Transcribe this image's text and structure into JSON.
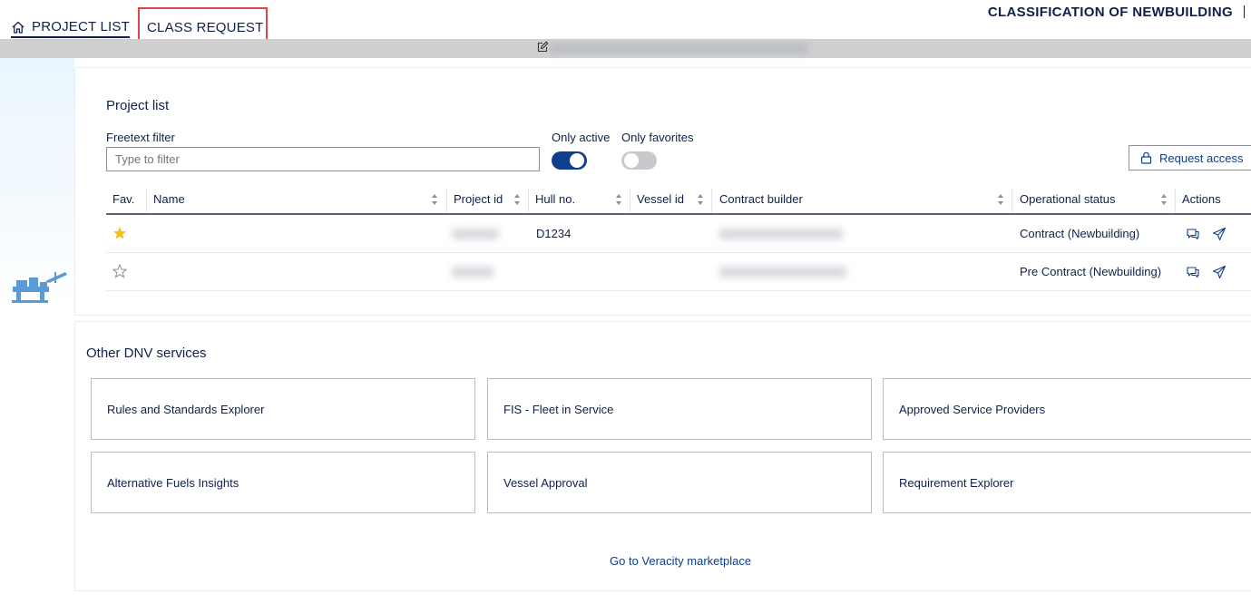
{
  "nav": {
    "project_list_label": "PROJECT LIST",
    "class_request_label": "CLASS REQUEST",
    "app_title": "CLASSIFICATION OF NEWBUILDING"
  },
  "project_list": {
    "title": "Project list",
    "freetext_label": "Freetext filter",
    "filter_placeholder": "Type to filter",
    "filter_value": "",
    "only_active_label": "Only active",
    "only_active_on": true,
    "only_favorites_label": "Only favorites",
    "only_favorites_on": false,
    "request_access_label": "Request access",
    "columns": [
      "Fav.",
      "Name",
      "Project id",
      "Hull no.",
      "Vessel id",
      "Contract builder",
      "Operational status",
      "Actions"
    ],
    "rows": [
      {
        "favorite": true,
        "name": "",
        "hull_no": "D1234",
        "vessel_id": "",
        "operational_status": "Contract (Newbuilding)"
      },
      {
        "favorite": false,
        "name": "",
        "hull_no": "",
        "vessel_id": "",
        "operational_status": "Pre Contract (Newbuilding)"
      }
    ]
  },
  "services": {
    "title": "Other DNV services",
    "tiles": [
      "Rules and Standards Explorer",
      "FIS - Fleet in Service",
      "Approved Service Providers",
      "Alternative Fuels Insights",
      "Vessel Approval",
      "Requirement Explorer"
    ],
    "marketplace_link": "Go to Veracity marketplace"
  },
  "colors": {
    "navy": "#0f204b",
    "toggle_on": "#0f3e8c",
    "highlight": "#e04646",
    "star_filled": "#f5c118"
  },
  "icons": {
    "home": "home-icon",
    "edit": "edit-icon",
    "lock": "lock-icon",
    "star": "star-icon",
    "comment": "comment-icon",
    "send": "send-icon",
    "sort": "sort-icon"
  }
}
